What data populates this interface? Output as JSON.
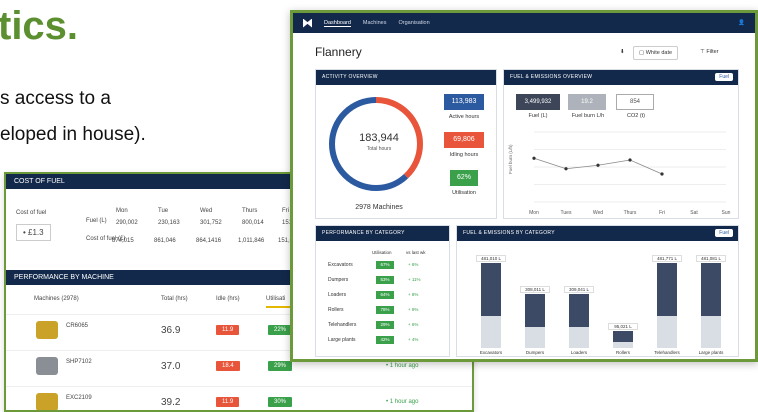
{
  "heading": "tics.",
  "paragraph": {
    "line1": "s access to a",
    "line2": "eloped in house)."
  },
  "back_window": {
    "fuel_panel": {
      "title": "COST OF FUEL",
      "cost_label": "Cost of fuel",
      "cost_value": "• £1.3",
      "days": [
        "Mon",
        "Tue",
        "Wed",
        "Thurs",
        "Fri"
      ],
      "row1_label": "Fuel (L)",
      "row1": [
        "290,002",
        "230,163",
        "301,752",
        "800,014",
        "151,032"
      ],
      "row2_label": "Cost of fuel (£)",
      "row2": [
        "874,015",
        "861,046",
        "864,1416",
        "1,011,846",
        "151,021"
      ]
    },
    "perf_title": "PERFORMANCE BY MACHINE",
    "columns": [
      "Machines (2978)",
      "Total (hrs)",
      "Idle (hrs)",
      "Utilisati"
    ],
    "rows": [
      {
        "id": "CR6065",
        "total": "36.9",
        "idle": "11.9",
        "util": "22%",
        "extra": ""
      },
      {
        "id": "SHP7102",
        "total": "37.0",
        "idle": "18.4",
        "util": "29%",
        "extra": "• 1 hour ago"
      },
      {
        "id": "EXC2109",
        "total": "39.2",
        "idle": "11.9",
        "util": "30%",
        "extra": "• 1 hour ago"
      }
    ]
  },
  "app": {
    "nav": {
      "items": [
        "Dashboard",
        "Machines",
        "Organisation"
      ],
      "user_icon": "user-icon"
    },
    "page_title": "Flannery",
    "toolbar": {
      "download": "⬇",
      "date": "White date",
      "filter": "Filter"
    },
    "activity": {
      "title": "ACTIVITY OVERVIEW",
      "total": "183,944",
      "total_label": "Total hours",
      "machines": "2978 Machines",
      "stats": [
        {
          "value": "113,983",
          "label": "Active hours",
          "color": "#2c5aa0"
        },
        {
          "value": "69,806",
          "label": "Idling hours",
          "color": "#e8553a"
        },
        {
          "value": "62%",
          "label": "Utilisation",
          "color": "#3aa04a"
        }
      ]
    },
    "fuel_overview": {
      "title": "FUEL & EMISSIONS OVERVIEW",
      "toggle": "Fuel",
      "boxes": [
        {
          "value": "3,499,932",
          "label": "Fuel (L)"
        },
        {
          "value": "19.2",
          "label": "Fuel burn L/h"
        },
        {
          "value": "854",
          "label": "CO2 (t)"
        }
      ],
      "y_label": "Fuel burn (L/h)",
      "days": [
        "Mon",
        "Tues",
        "Wed",
        "Thurs",
        "Fri",
        "Sat",
        "Sun"
      ]
    },
    "perf_category": {
      "title": "PERFORMANCE BY CATEGORY",
      "col1": "Utilisation",
      "col2": "vs last wk",
      "rows": [
        {
          "name": "Excavators",
          "util": "67%",
          "change": "+ 6%"
        },
        {
          "name": "Dumpers",
          "util": "53%",
          "change": "+ 11%"
        },
        {
          "name": "Loaders",
          "util": "64%",
          "change": "+ 8%"
        },
        {
          "name": "Rollers",
          "util": "78%",
          "change": "+ 9%"
        },
        {
          "name": "Telehandlers",
          "util": "29%",
          "change": "+ 6%"
        },
        {
          "name": "Large plants",
          "util": "42%",
          "change": "+ 4%"
        }
      ]
    },
    "fuel_category": {
      "title": "FUEL & EMISSIONS BY CATEGORY",
      "toggle": "Fuel"
    }
  },
  "chart_data": [
    {
      "type": "line",
      "x": [
        "Mon",
        "Tues",
        "Wed",
        "Thurs",
        "Fri",
        "Sat",
        "Sun"
      ],
      "series": [
        {
          "values": [
            18.5,
            17.9,
            18.1,
            18.4,
            17.6,
            null,
            null
          ]
        }
      ],
      "ylabel": "Fuel burn (L/h)"
    },
    {
      "type": "bar",
      "categories": [
        "Excavators",
        "Dumpers",
        "Loaders",
        "Rollers",
        "Telehandlers",
        "Large plants"
      ],
      "values": [
        481,
        308,
        309,
        95,
        481,
        481
      ],
      "labels": [
        "481,010 L",
        "308,011 L",
        "309,041 L",
        "95,021 L",
        "481,771 L",
        "481,081 L"
      ]
    }
  ]
}
